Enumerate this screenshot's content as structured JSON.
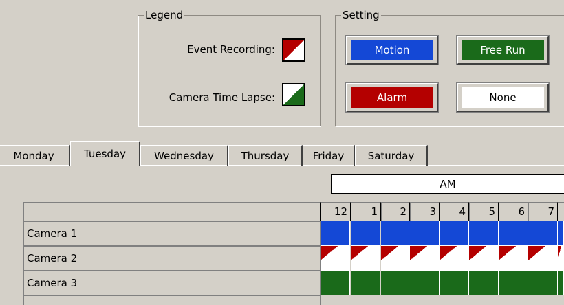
{
  "legend": {
    "title": "Legend",
    "items": [
      {
        "label": "Event Recording:",
        "icon": "event-recording-swatch"
      },
      {
        "label": "Camera Time Lapse:",
        "icon": "time-lapse-swatch"
      }
    ]
  },
  "setting": {
    "title": "Setting",
    "buttons": [
      {
        "label": "Motion",
        "bg": "#1448d6",
        "fg": "#ffffff"
      },
      {
        "label": "Free Run",
        "bg": "#1a6a1a",
        "fg": "#ffffff"
      },
      {
        "label": "Alarm",
        "bg": "#b40000",
        "fg": "#ffffff"
      },
      {
        "label": "None",
        "bg": "#ffffff",
        "fg": "#000000"
      }
    ]
  },
  "tabs": [
    "Monday",
    "Tuesday",
    "Wednesday",
    "Thursday",
    "Friday",
    "Saturday"
  ],
  "active_tab": "Tuesday",
  "schedule": {
    "period": "AM",
    "hours": [
      "12",
      "1",
      "2",
      "3",
      "4",
      "5",
      "6",
      "7"
    ],
    "rows": [
      {
        "label": "Camera 1",
        "mode": "motion"
      },
      {
        "label": "Camera 2",
        "mode": "event"
      },
      {
        "label": "Camera 3",
        "mode": "freerun"
      }
    ]
  },
  "colors": {
    "motion": "#1448d6",
    "free_run": "#1a6a1a",
    "alarm": "#b40000",
    "window_bg": "#d4d0c8"
  }
}
